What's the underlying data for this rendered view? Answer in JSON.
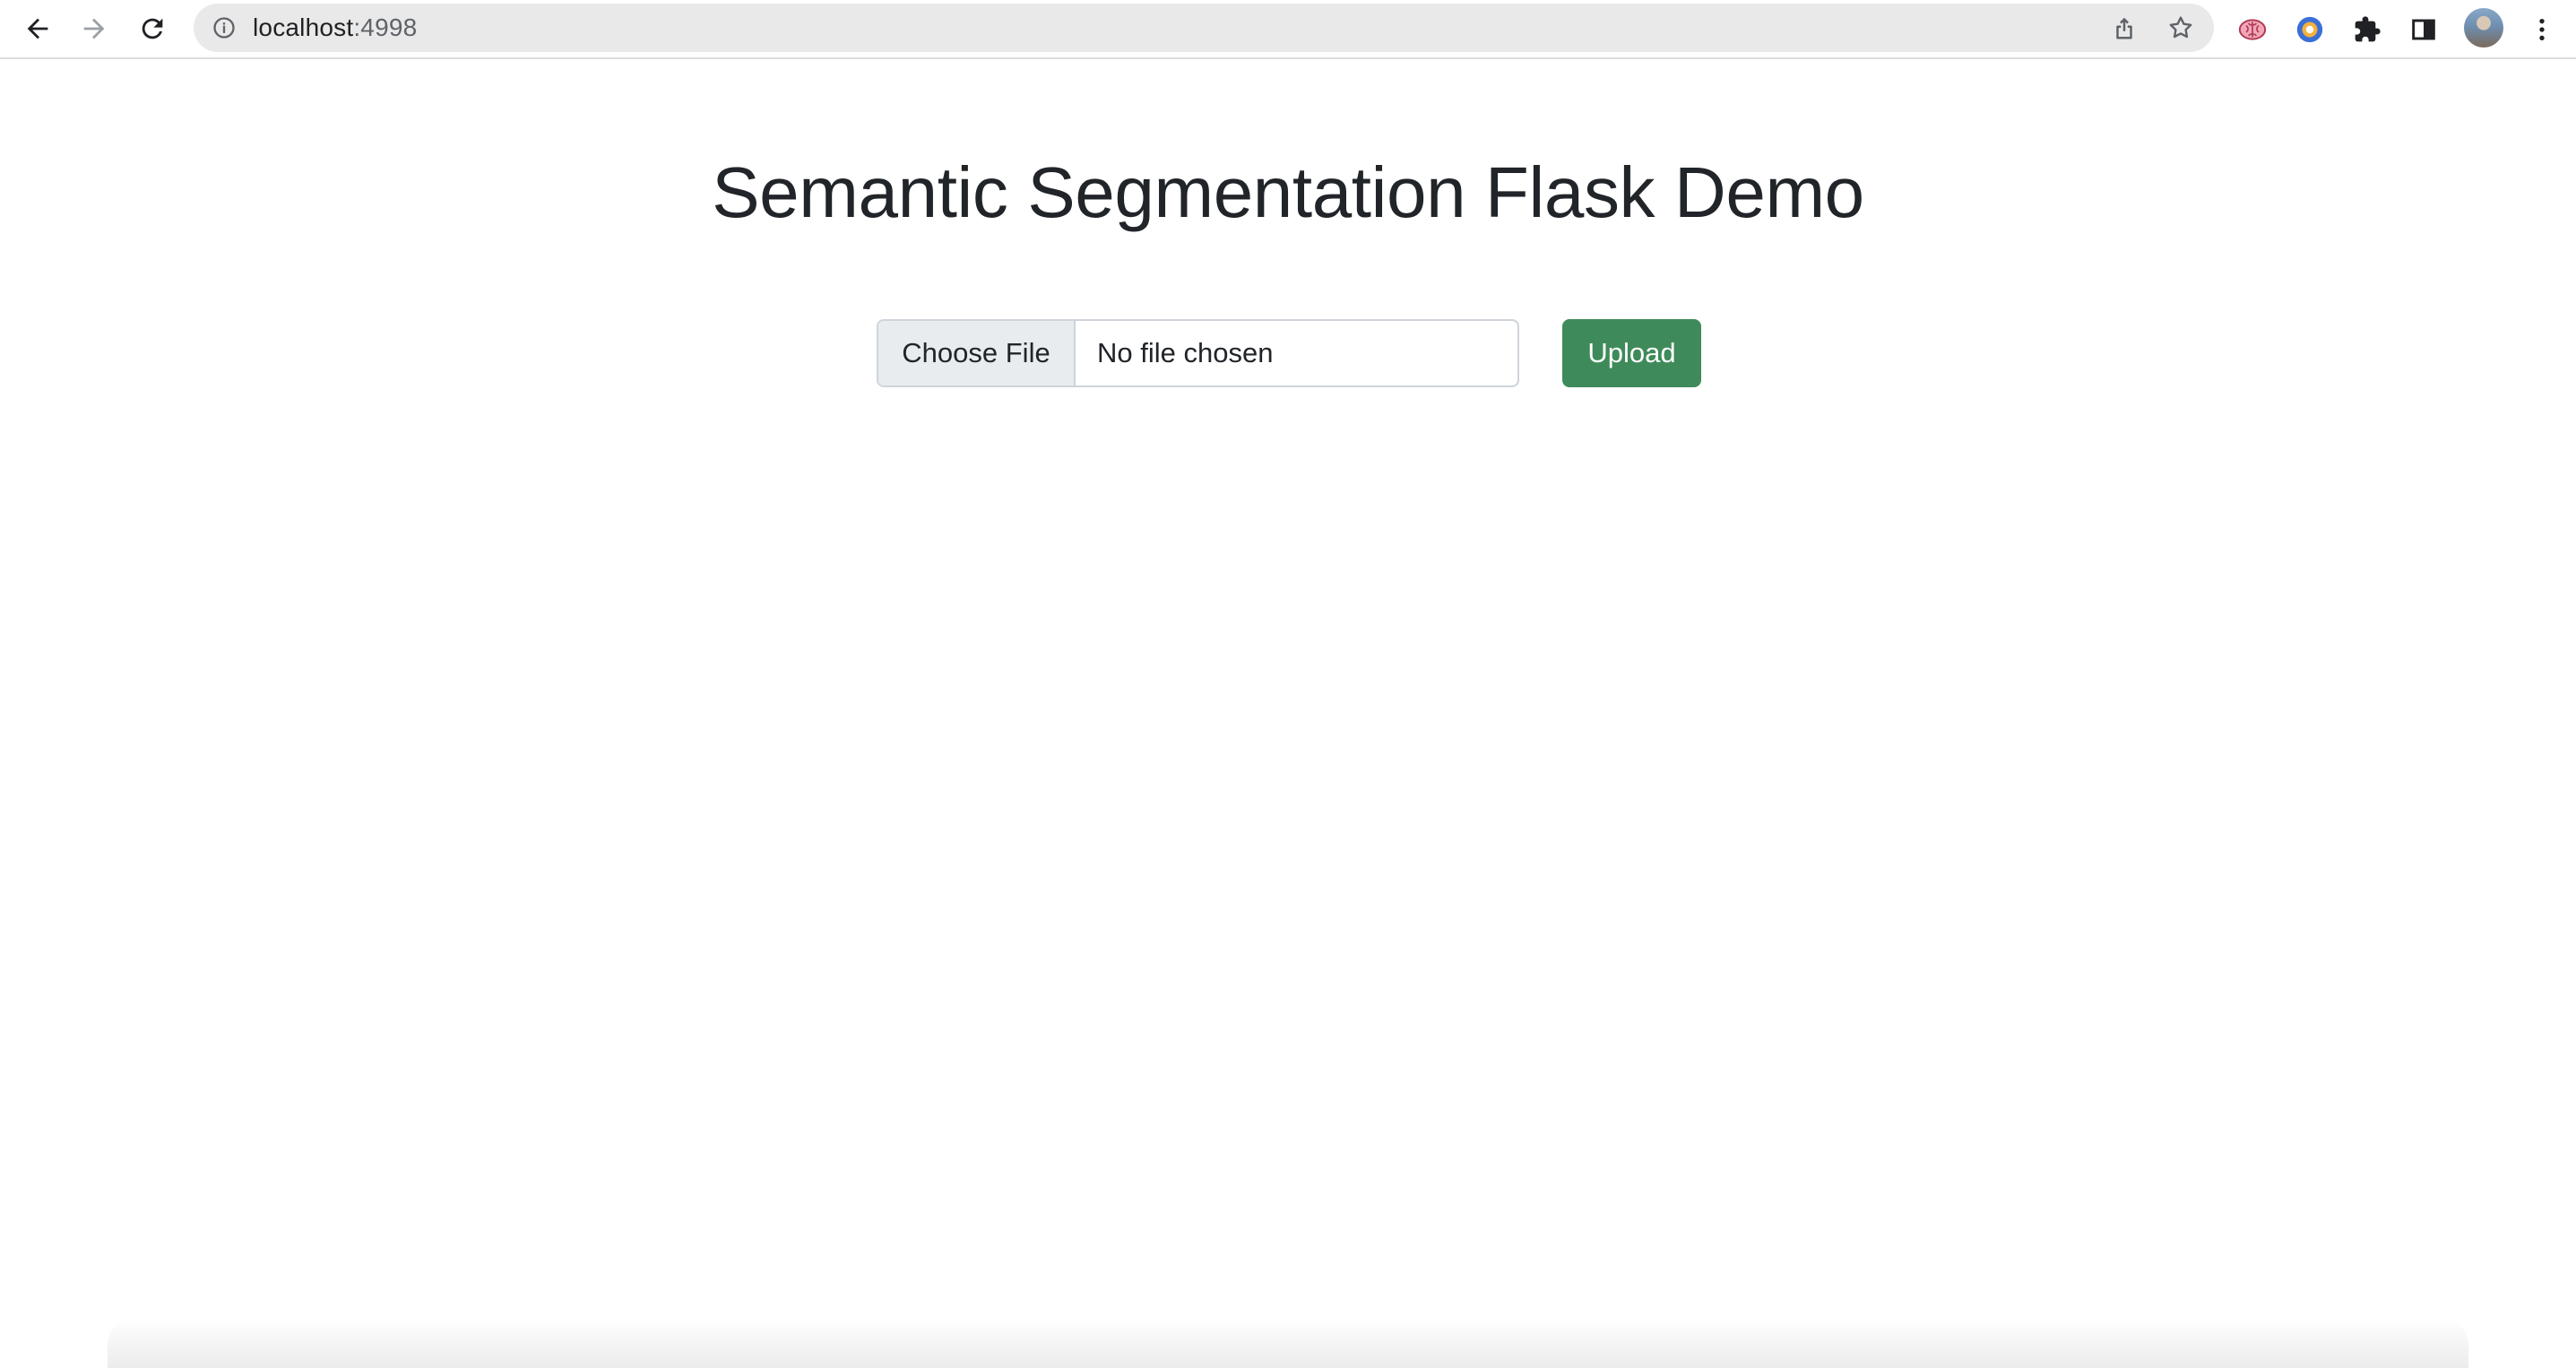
{
  "browser": {
    "url_host": "localhost",
    "url_port": ":4998",
    "icons": {
      "back": "arrow-left-icon",
      "forward": "arrow-right-icon",
      "reload": "reload-icon",
      "site_info": "info-icon",
      "share": "share-icon",
      "bookmark": "star-icon",
      "extension_1": "brain-icon",
      "extension_2": "donut-icon",
      "extensions": "puzzle-icon",
      "side_panel": "side-panel-icon",
      "menu": "kebab-menu-icon"
    }
  },
  "page": {
    "title": "Semantic Segmentation Flask Demo",
    "file_input": {
      "button_label": "Choose File",
      "status_text": "No file chosen"
    },
    "upload_label": "Upload",
    "colors": {
      "upload_bg": "#3f8a5a",
      "title_text": "#212529",
      "input_border": "#ced4da",
      "choose_file_bg": "#e9ecef"
    }
  }
}
